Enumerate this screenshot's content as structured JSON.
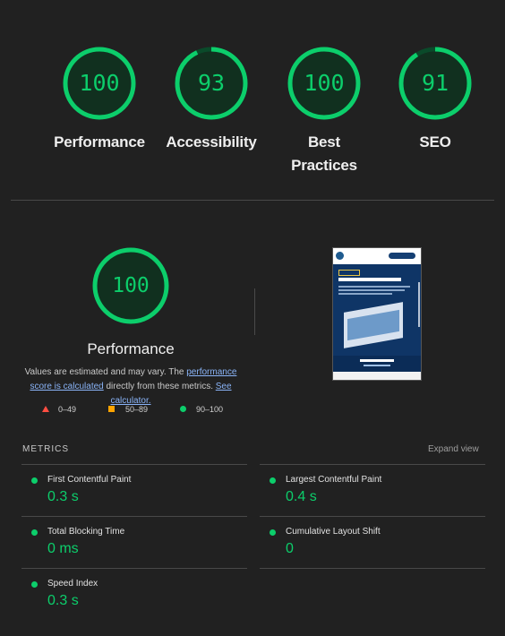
{
  "summary_gauges": [
    {
      "score": "100",
      "label": "Performance"
    },
    {
      "score": "93",
      "label": "Accessibility"
    },
    {
      "score": "100",
      "label": "Best Practices"
    },
    {
      "score": "91",
      "label": "SEO"
    }
  ],
  "detail": {
    "score": "100",
    "title": "Performance",
    "desc_prefix": "Values are estimated and may vary. The ",
    "link_score": "performance score is calculated",
    "desc_middle": " directly from these metrics. ",
    "link_calc": "See calculator."
  },
  "legend": [
    {
      "range": "0–49",
      "shape": "triangle",
      "color": "#ff4e42"
    },
    {
      "range": "50–89",
      "shape": "square",
      "color": "#ffa400"
    },
    {
      "range": "90–100",
      "shape": "circle",
      "color": "#0cce6b"
    }
  ],
  "metrics": {
    "title": "METRICS",
    "expand_label": "Expand view",
    "items": [
      {
        "label": "First Contentful Paint",
        "value": "0.3 s"
      },
      {
        "label": "Largest Contentful Paint",
        "value": "0.4 s"
      },
      {
        "label": "Total Blocking Time",
        "value": "0 ms"
      },
      {
        "label": "Cumulative Layout Shift",
        "value": "0"
      },
      {
        "label": "Speed Index",
        "value": "0.3 s"
      }
    ]
  },
  "colors": {
    "pass": "#0cce6b",
    "background": "#212121"
  }
}
